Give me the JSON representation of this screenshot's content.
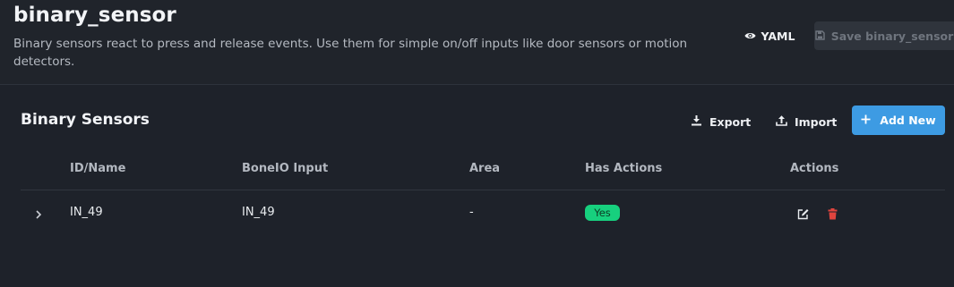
{
  "header": {
    "title": "binary_sensor",
    "description": "Binary sensors react to press and release events. Use them for simple on/off inputs like door sensors or motion detectors.",
    "yaml_label": "YAML",
    "save_label": "Save binary_sensor"
  },
  "section": {
    "title": "Binary Sensors",
    "export_label": "Export",
    "import_label": "Import",
    "add_new_label": "Add New"
  },
  "table": {
    "columns": [
      "ID/Name",
      "BoneIO Input",
      "Area",
      "Has Actions",
      "Actions"
    ],
    "rows": [
      {
        "id_name": "IN_49",
        "boneio_input": "IN_49",
        "area": "-",
        "has_actions": "Yes"
      }
    ]
  },
  "colors": {
    "background": "#1e222a",
    "accent": "#3d9be3",
    "success": "#17d07e",
    "danger": "#e0443e"
  }
}
